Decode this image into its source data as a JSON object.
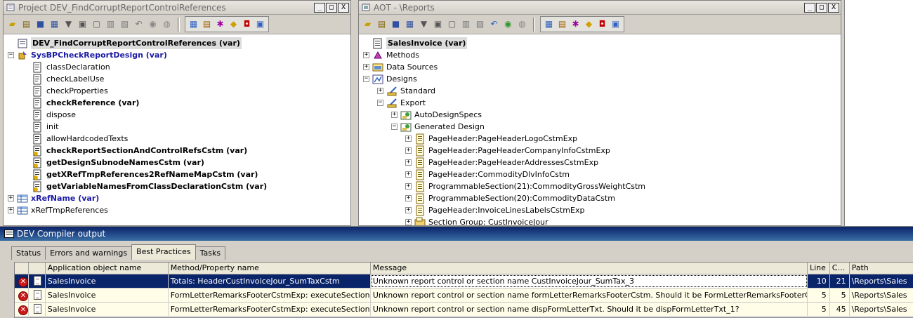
{
  "project_window": {
    "title": "Project DEV_FindCorruptReportControlReferences",
    "title_buttons": [
      "_",
      "□",
      "X"
    ],
    "tree": [
      {
        "label": "DEV_FindCorruptReportControlReferences (var)",
        "level": 0,
        "expander": "",
        "icon": "project-icon",
        "bold": true,
        "selected": true
      },
      {
        "label": "SysBPCheckReportDesign (var)",
        "level": 0,
        "expander": "−",
        "icon": "class-icon",
        "bold": true,
        "blue": true
      },
      {
        "label": "classDeclaration",
        "level": 1,
        "expander": "",
        "icon": "method-icon"
      },
      {
        "label": "checkLabelUse",
        "level": 1,
        "expander": "",
        "icon": "method-icon"
      },
      {
        "label": "checkProperties",
        "level": 1,
        "expander": "",
        "icon": "method-icon"
      },
      {
        "label": "checkReference (var)",
        "level": 1,
        "expander": "",
        "icon": "method-icon",
        "bold": true
      },
      {
        "label": "dispose",
        "level": 1,
        "expander": "",
        "icon": "method-icon"
      },
      {
        "label": "init",
        "level": 1,
        "expander": "",
        "icon": "method-icon"
      },
      {
        "label": "allowHardcodedTexts",
        "level": 1,
        "expander": "",
        "icon": "method-icon"
      },
      {
        "label": "checkReportSectionAndControlRefsCstm (var)",
        "level": 1,
        "expander": "",
        "icon": "method-new-icon",
        "bold": true
      },
      {
        "label": "getDesignSubnodeNamesCstm (var)",
        "level": 1,
        "expander": "",
        "icon": "method-new-icon",
        "bold": true
      },
      {
        "label": "getXRefTmpReferences2RefNameMapCstm (var)",
        "level": 1,
        "expander": "",
        "icon": "method-new-icon",
        "bold": true
      },
      {
        "label": "getVariableNamesFromClassDeclarationCstm (var)",
        "level": 1,
        "expander": "",
        "icon": "method-new-icon",
        "bold": true
      },
      {
        "label": "xRefName (var)",
        "level": 0,
        "expander": "+",
        "icon": "table-icon",
        "bold": true,
        "blue": true
      },
      {
        "label": "xRefTmpReferences",
        "level": 0,
        "expander": "+",
        "icon": "table-icon"
      }
    ]
  },
  "aot_window": {
    "title": "AOT - \\Reports",
    "title_buttons": [
      "_",
      "□",
      "X"
    ],
    "tree": [
      {
        "label": "SalesInvoice (var)",
        "level": 0,
        "expander": "",
        "icon": "report-icon",
        "bold": true,
        "selected": true
      },
      {
        "label": "Methods",
        "level": 0,
        "expander": "+",
        "icon": "methods-icon"
      },
      {
        "label": "Data Sources",
        "level": 0,
        "expander": "+",
        "icon": "datasource-icon"
      },
      {
        "label": "Designs",
        "level": 0,
        "expander": "−",
        "icon": "designs-icon"
      },
      {
        "label": "Standard",
        "level": 1,
        "expander": "+",
        "icon": "design-icon"
      },
      {
        "label": "Export",
        "level": 1,
        "expander": "−",
        "icon": "design-icon"
      },
      {
        "label": "AutoDesignSpecs",
        "level": 2,
        "expander": "+",
        "icon": "autodesign-icon"
      },
      {
        "label": "Generated Design",
        "level": 2,
        "expander": "−",
        "icon": "autodesign-icon"
      },
      {
        "label": "PageHeader:PageHeaderLogoCstmExp",
        "level": 3,
        "expander": "+",
        "icon": "section-icon"
      },
      {
        "label": "PageHeader:PageHeaderCompanyInfoCstmExp",
        "level": 3,
        "expander": "+",
        "icon": "section-icon"
      },
      {
        "label": "PageHeader:PageHeaderAddressesCstmExp",
        "level": 3,
        "expander": "+",
        "icon": "section-icon"
      },
      {
        "label": "PageHeader:CommodityDlvInfoCstm",
        "level": 3,
        "expander": "+",
        "icon": "section-icon"
      },
      {
        "label": "ProgrammableSection(21):CommodityGrossWeightCstm",
        "level": 3,
        "expander": "+",
        "icon": "section-icon"
      },
      {
        "label": "ProgrammableSection(20):CommodityDataCstm",
        "level": 3,
        "expander": "+",
        "icon": "section-icon"
      },
      {
        "label": "PageHeader:InvoiceLinesLabelsCstmExp",
        "level": 3,
        "expander": "+",
        "icon": "section-icon"
      },
      {
        "label": "Section Group: CustInvoiceJour",
        "level": 3,
        "expander": "+",
        "icon": "section-group-icon"
      }
    ]
  },
  "compiler": {
    "title": "DEV Compiler output",
    "tabs": [
      {
        "label": "Status",
        "active": false
      },
      {
        "label": "Errors and warnings",
        "active": false
      },
      {
        "label": "Best Practices",
        "active": true
      },
      {
        "label": "Tasks",
        "active": false
      }
    ],
    "columns": [
      "",
      "",
      "Application object name",
      "Method/Property name",
      "Message",
      "Line",
      "C...",
      "Path"
    ],
    "rows": [
      {
        "object": "SalesInvoice",
        "method": "Totals: HeaderCustInvoiceJour_SumTaxCstm",
        "message": "Unknown report control or section name CustInvoiceJour_SumTax_3",
        "line": "10",
        "col": "21",
        "path": "\\Reports\\Sales",
        "selected": true
      },
      {
        "object": "SalesInvoice",
        "method": "FormLetterRemarksFooterCstmExp: executeSection",
        "message": "Unknown report control or section name formLetterRemarksFooterCstm. Should it be FormLetterRemarksFooterCstmExp?",
        "line": "5",
        "col": "5",
        "path": "\\Reports\\Sales",
        "selected": false
      },
      {
        "object": "SalesInvoice",
        "method": "FormLetterRemarksFooterCstmExp: executeSection",
        "message": "Unknown report control or section name dispFormLetterTxt. Should it be dispFormLetterTxt_1?",
        "line": "5",
        "col": "45",
        "path": "\\Reports\\Sales",
        "selected": false
      }
    ]
  },
  "colors": {
    "selection_blue": "#0a246a",
    "error_red": "#cc1a1a",
    "row_yellow": "#fffde8",
    "class_blue": "#1a1aa6"
  }
}
